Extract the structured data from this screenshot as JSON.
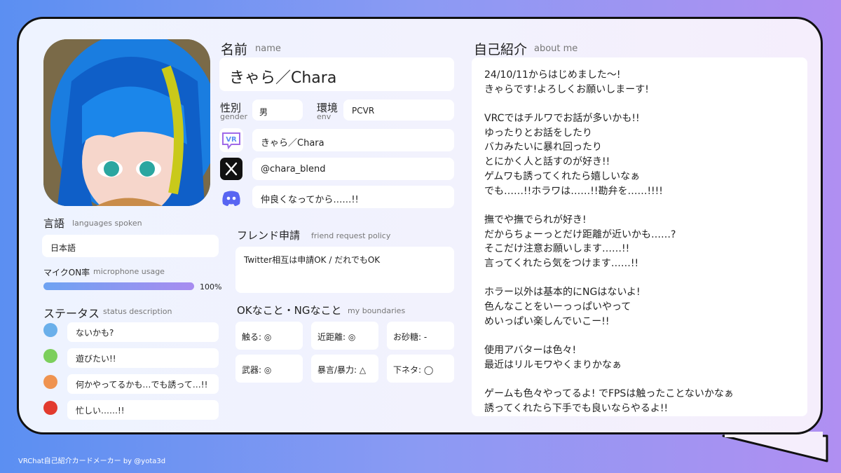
{
  "colors": {
    "bg_left": "#5b8ff2",
    "bg_right": "#b08ff2",
    "card": "#f0f2fd",
    "border": "#111111"
  },
  "name": {
    "label_ja": "名前",
    "label_en": "name",
    "value": "きゃら／Chara"
  },
  "gender": {
    "label_ja": "性別",
    "label_en": "gender",
    "value": "男"
  },
  "env": {
    "label_ja": "環境",
    "label_en": "env",
    "value": "PCVR"
  },
  "accounts": {
    "vrchat": {
      "icon": "vrchat-icon",
      "value": "きゃら／Chara"
    },
    "x": {
      "icon": "x-icon",
      "value": "@chara_blend"
    },
    "discord": {
      "icon": "discord-icon",
      "value": "仲良くなってから……!!"
    }
  },
  "languages": {
    "label_ja": "言語",
    "label_en": "languages spoken",
    "value": "日本語"
  },
  "mic": {
    "label_ja": "マイクON率",
    "label_en": "microphone usage",
    "percent": 100,
    "percent_text": "100%"
  },
  "status": {
    "label_ja": "ステータス",
    "label_en": "status description",
    "items": [
      {
        "color": "#6aafea",
        "text": "ないかも?"
      },
      {
        "color": "#7ccf5c",
        "text": "遊びたい!!"
      },
      {
        "color": "#ef9350",
        "text": "何かやってるかも…でも誘って…!!"
      },
      {
        "color": "#e23a2e",
        "text": "忙しい……!!"
      }
    ]
  },
  "friend": {
    "label_ja": "フレンド申請",
    "label_en": "friend request policy",
    "value": "Twitter相互は申請OK / だれでもOK"
  },
  "boundaries": {
    "label_ja": "OKなこと・NGなこと",
    "label_en": "my boundaries",
    "cells": [
      "触る: ◎",
      "近距離: ◎",
      "お砂糖: -",
      "武器: ◎",
      "暴言/暴力: △",
      "下ネタ: ◯"
    ]
  },
  "about": {
    "label_ja": "自己紹介",
    "label_en": "about me",
    "lines": [
      "24/10/11からはじめました〜!",
      "きゃらです!よろしくお願いしまーす!",
      "",
      "VRCではチルワでお話が多いかも!!",
      "ゆったりとお話をしたり",
      "バカみたいに暴れ回ったり",
      "とにかく人と話すのが好き!!",
      "ゲムワも誘ってくれたら嬉しいなぁ",
      "でも……!!ホラワは……!!勘弁を……!!!!",
      "",
      "撫でや撫でられが好き!",
      "だからちょーっとだけ距離が近いかも……?",
      "そこだけ注意お願いします……!!",
      "言ってくれたら気をつけます……!!",
      "",
      "ホラー以外は基本的にNGはないよ!",
      "色んなことをいーっっぱいやって",
      "めいっぱい楽しんでいこー!!",
      "",
      "使用アバターは色々!",
      "最近はリルモワやくまりかなぁ",
      "",
      "ゲームも色々やってるよ! でFPSは触ったことないかなぁ",
      "誘ってくれたら下手でも良いならやるよ!!"
    ]
  },
  "footer": "VRChat自己紹介カードメーカー by @yota3d"
}
